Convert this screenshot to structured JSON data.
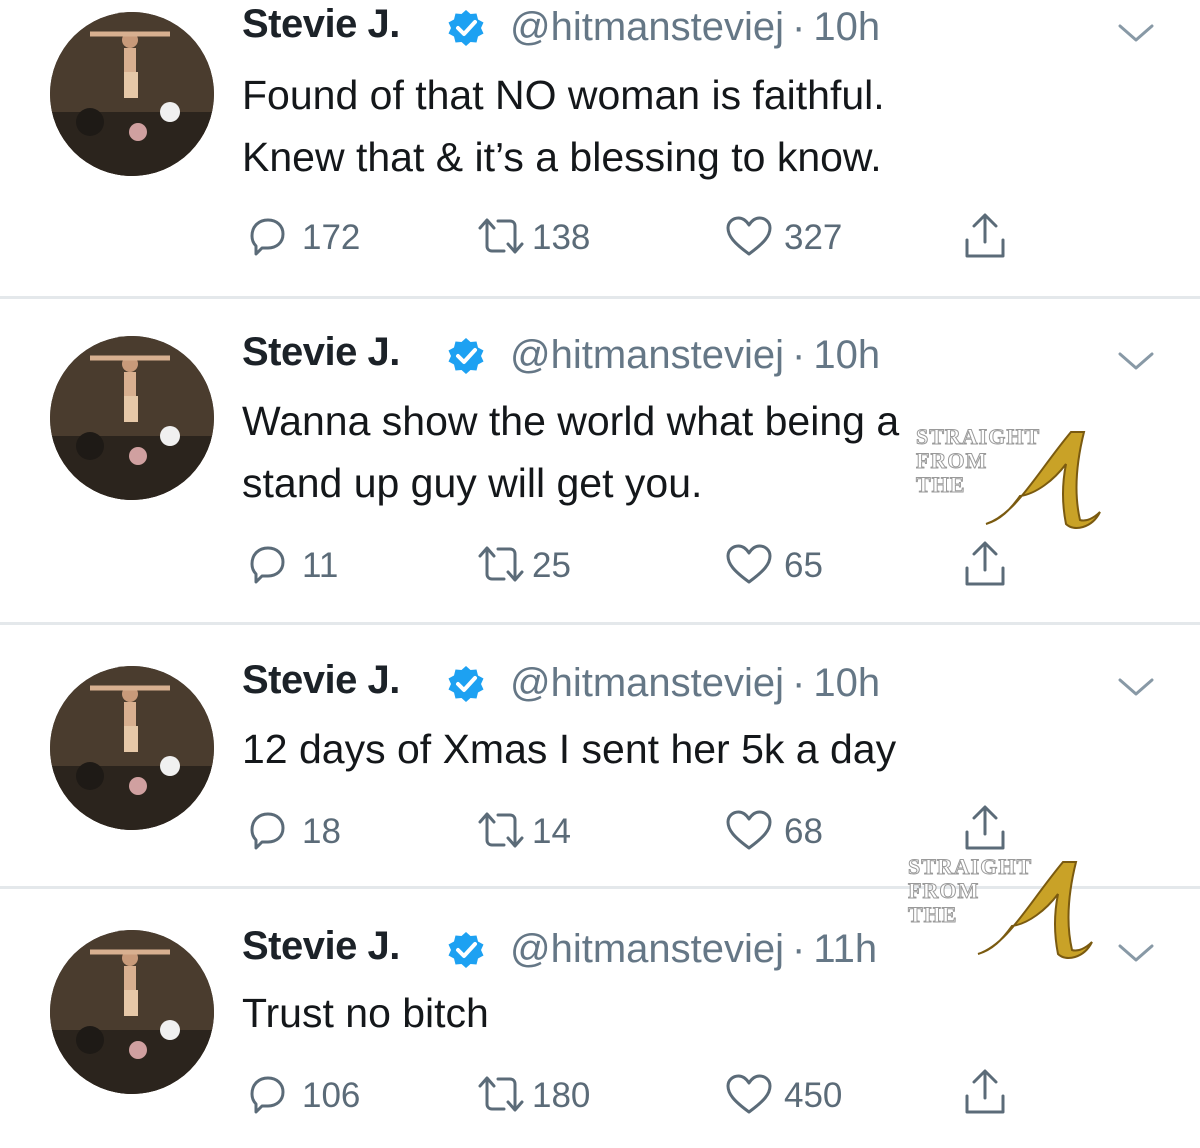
{
  "tweets": [
    {
      "name": "Stevie J.",
      "handle": "@hitmansteviej",
      "time": "10h",
      "lines": [
        "Found of that NO woman is faithful.",
        "Knew that & it’s a blessing to know."
      ],
      "replies": "172",
      "retweets": "138",
      "likes": "327"
    },
    {
      "name": "Stevie J.",
      "handle": "@hitmansteviej",
      "time": "10h",
      "lines": [
        "Wanna show the world what being a",
        "stand up guy will get you."
      ],
      "replies": "11",
      "retweets": "25",
      "likes": "65"
    },
    {
      "name": "Stevie J.",
      "handle": "@hitmansteviej",
      "time": "10h",
      "lines": [
        "12 days of Xmas I sent her 5k a day"
      ],
      "replies": "18",
      "retweets": "14",
      "likes": "68"
    },
    {
      "name": "Stevie J.",
      "handle": "@hitmansteviej",
      "time": "11h",
      "lines": [
        "Trust no bitch"
      ],
      "replies": "106",
      "retweets": "180",
      "likes": "450"
    }
  ],
  "watermark": {
    "line1": "STRAIGHT",
    "line2": "FROM",
    "line3": "THE"
  },
  "colors": {
    "verified": "#1da1f2",
    "meta_gray": "#657786",
    "divider": "#e4e8eb",
    "watermark_gold": "#c9a227"
  }
}
